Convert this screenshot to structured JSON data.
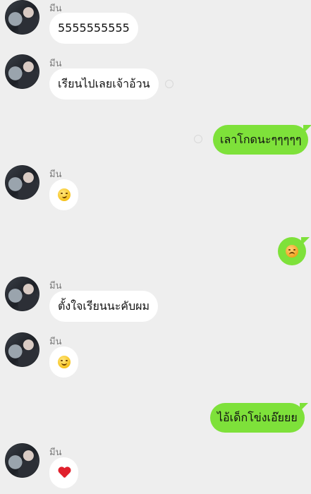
{
  "chat": {
    "sender_name": "มีน",
    "messages": [
      {
        "side": "in",
        "text": "5555555555"
      },
      {
        "side": "in",
        "text": "เรียนไปเลยเจ้าอ้วน"
      },
      {
        "side": "out",
        "text": "เลาโกดนะๆๆๆๆๆ"
      },
      {
        "side": "in",
        "emoji": "smirking-face"
      },
      {
        "side": "out",
        "emoji": "angry-face"
      },
      {
        "side": "in",
        "text": "ตั้งใจเรียนนะคับผม"
      },
      {
        "side": "in",
        "emoji": "smiling-face"
      },
      {
        "side": "out",
        "text": "ไอ้เด็กโข่งเอ๊ยยย"
      },
      {
        "side": "in",
        "emoji": "red-heart"
      }
    ]
  }
}
